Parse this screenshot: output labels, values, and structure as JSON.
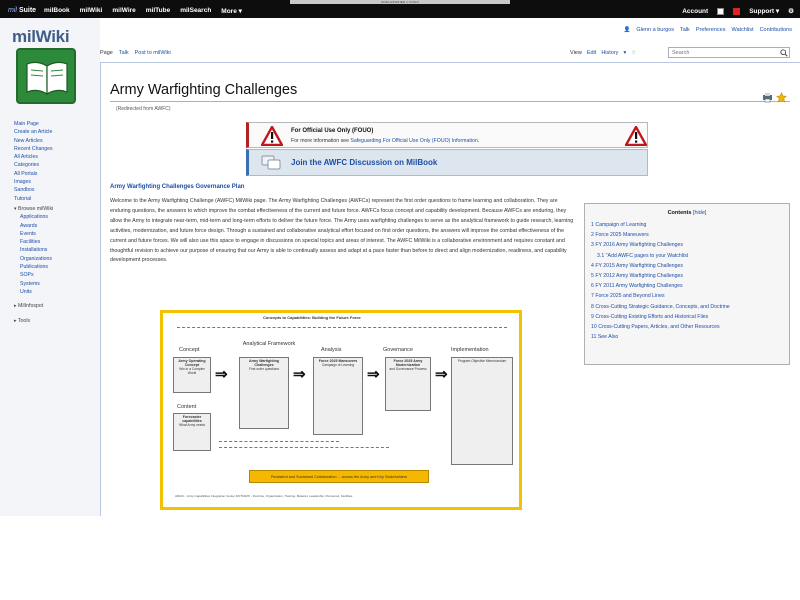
{
  "window": {
    "banner": "UNCLASSIFIED // FOUO"
  },
  "topbar": {
    "brand_prefix": "mil",
    "brand_suffix": "Suite",
    "nav": [
      "milBook",
      "milWiki",
      "milWire",
      "milTube",
      "milSearch",
      "More ▾"
    ],
    "account": "Account",
    "support": "Support ▾"
  },
  "logo": {
    "text": "milWiki"
  },
  "userlinks": [
    "Glenn a burgos",
    "Talk",
    "Preferences",
    "Watchlist",
    "Contributions"
  ],
  "tabs": {
    "page": "Page",
    "talk": "Talk",
    "post": "Post to milWiki",
    "view": "View",
    "edit": "Edit",
    "history": "History",
    "more": "▾",
    "search_placeholder": "Search"
  },
  "sidebar": {
    "items": [
      "Main Page",
      "Create an Article",
      "New Articles",
      "Recent Changes",
      "All Articles",
      "Categories",
      "All Portals",
      "Images",
      "Sandbox",
      "Tutorial"
    ],
    "browse_header": "▾ Browse milWiki",
    "browse_items": [
      "Applications",
      "Awards",
      "Events",
      "Facilities",
      "Installations",
      "Organizations",
      "Publications",
      "SOPs",
      "Systems",
      "Units"
    ],
    "milinfospot": "▸ MilInfospot",
    "tools": "▸ Tools"
  },
  "page": {
    "title": "Army Warfighting Challenges",
    "redirect": "(Redirected from AWFC)"
  },
  "fouo": {
    "title": "For Official Use Only (FOUO)",
    "text_prefix": "For more information see ",
    "link": "Safeguarding For Official Use Only (FOUO) Information",
    "text_suffix": "."
  },
  "join": {
    "text": "Join the AWFC Discussion on MilBook"
  },
  "section_heading": "Army Warfighting Challenges Governance Plan",
  "intro": "Welcome to the Army Warfighting Challenge (AWFC) MilWiki page. The Army Warfighting Challenges (AWFCs) represent the first order questions to frame learning and collaboration. They are enduring questions, the answers to which improve the combat effectiveness of the current and future force. AWFCs focus concept and capability development. Because AWFCs are enduring, they allow the Army to integrate near-term, mid-term and long-term efforts to deliver the future force. The Army uses warfighting challenges to serve as the analytical framework to guide research, learning activities, modernization, and future force design. Through a sustained and collaborative analytical effort focused on first order questions, the answers will improve the combat effectiveness of the current and future forces. We will also use this space to engage in discussions on special topics and areas of interest. The AWFC MilWiki is a collaborative environment and requires constant and thoughtful revision to achieve our purpose of ensuring that our Army is able to continually assess and adapt at a pace faster than before to direct and align modernization, readiness, and capability development processes.",
  "toc": {
    "title": "Contents",
    "hide": "[hide]",
    "items": [
      {
        "text": "1 Campaign of Learning",
        "sub": false
      },
      {
        "text": "2 Force 2025 Maneuvers",
        "sub": false
      },
      {
        "text": "3 FY 2016 Army Warfighting Challenges",
        "sub": false
      },
      {
        "text": "3.1 \"Add AWFC pages to your Watchlist",
        "sub": true
      },
      {
        "text": "4 FY 2015 Army Warfighting Challenges",
        "sub": false
      },
      {
        "text": "5 FY 2012 Army Warfighting Challenges",
        "sub": false
      },
      {
        "text": "6 FY 2011 Army Warfighting Challenges",
        "sub": false
      },
      {
        "text": "7 Force 2025 and Beyond Lines",
        "sub": false
      },
      {
        "text": "8 Cross-Cutting Strategic Guidance, Concepts, and Doctrine",
        "sub": false
      },
      {
        "text": "9 Cross-Cutting Existing Efforts and Historical Files",
        "sub": false
      },
      {
        "text": "10 Cross-Cutting Papers, Articles, and Other Resources",
        "sub": false
      },
      {
        "text": "11 See Also",
        "sub": false
      }
    ]
  },
  "diagram": {
    "title": "Concepts to Capabilities: Building the Future Force",
    "columns": [
      "Concept",
      "Analytical Framework",
      "Analysis",
      "Governance",
      "Implementation"
    ],
    "content_label": "Content",
    "boxes": {
      "concept_title": "Army Operating Concept",
      "concept_text": "Win in a Complex World",
      "content_title": "Forecaster capabilities",
      "content_text": "What Army needs",
      "framework_title": "Army Warfighting Challenges",
      "framework_text": "First order questions",
      "analysis_title": "Force 2025 Maneuvers",
      "analysis_text": "Campaign of Learning",
      "governance_title": "Force 2025 Army Modernization",
      "governance_text": "and Governance Process",
      "implementation_text": "Program Objective Memorandum"
    },
    "banner": "Persistent and Sustained Collaboration ... across the Army and Key Stakeholders",
    "footer": "ARCIC - Army Capabilities Integration Center   DOTMLPF - Doctrine, Organization, Training, Materiel, Leadership, Personnel, Facilities"
  },
  "colors": {
    "accent": "#1d4ea6",
    "diagram_border": "#f2c200",
    "banner": "#f5b700",
    "logo": "#2d8a3a"
  }
}
